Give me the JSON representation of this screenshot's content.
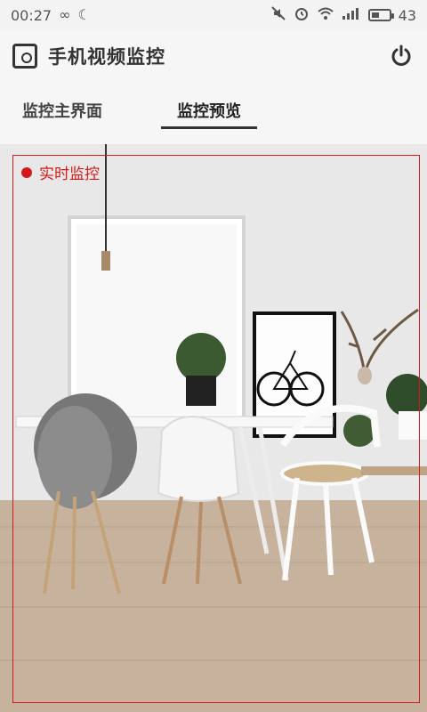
{
  "status_bar": {
    "time": "00:27",
    "battery_level": "43",
    "battery_fraction": 0.43,
    "icons_left": [
      "infinity-icon",
      "moon-icon"
    ],
    "icons_right": [
      "mute-icon",
      "alarm-icon",
      "wifi-icon",
      "signal-icon",
      "battery-icon"
    ]
  },
  "app_bar": {
    "title": "手机视频监控",
    "icon": "camera-icon",
    "action_icon": "power-icon"
  },
  "tabs": [
    {
      "label": "监控主界面",
      "active": false
    },
    {
      "label": "监控预览",
      "active": true
    }
  ],
  "preview": {
    "live_label": "实时监控",
    "accent_color": "#d31a1a"
  }
}
